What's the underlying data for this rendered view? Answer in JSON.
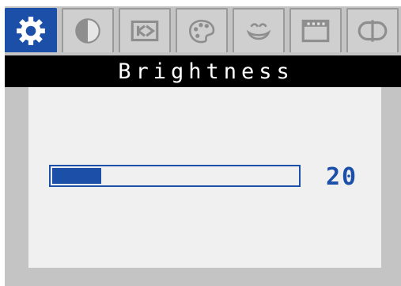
{
  "tabs": [
    {
      "icon": "gear-icon",
      "active": true
    },
    {
      "icon": "contrast-icon",
      "active": false
    },
    {
      "icon": "image-position-icon",
      "active": false
    },
    {
      "icon": "color-palette-icon",
      "active": false
    },
    {
      "icon": "face-icon",
      "active": false
    },
    {
      "icon": "display-icon",
      "active": false
    },
    {
      "icon": "input-icon",
      "active": false
    }
  ],
  "title": "Brightness",
  "brightness": {
    "value": "20",
    "level_percent": 20
  },
  "colors": {
    "accent": "#1c50a8",
    "background": "#c4c4c4",
    "panel": "#f0f0f0",
    "title_bar": "#000000"
  }
}
